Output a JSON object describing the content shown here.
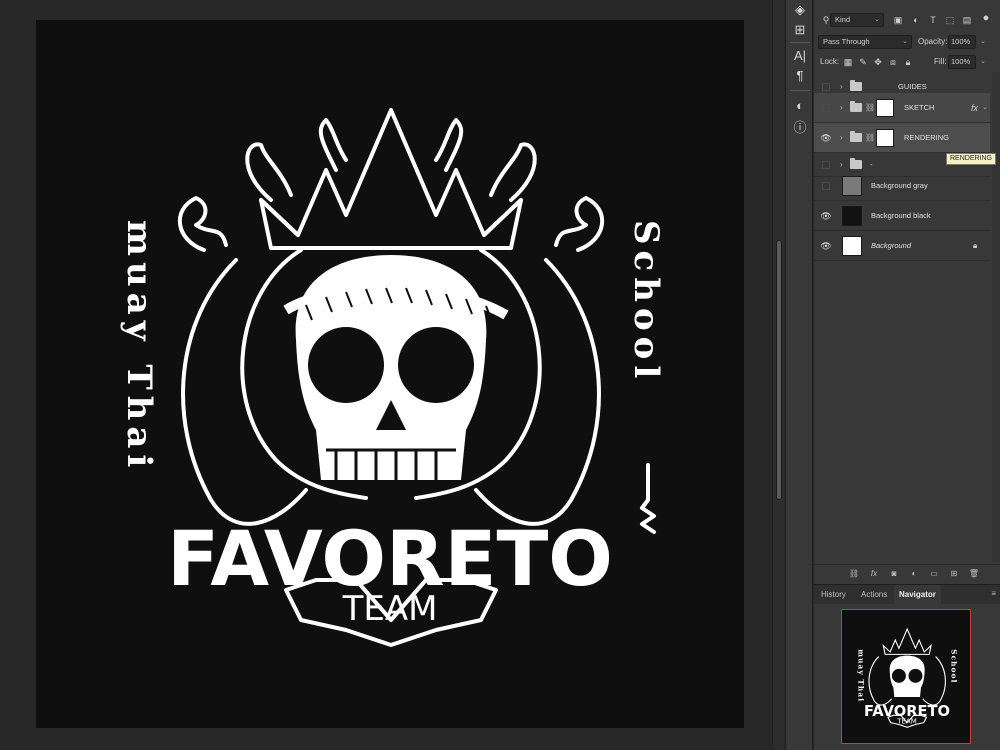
{
  "canvas": {
    "logo_top_text": "",
    "left_vertical_text": "muay Thai",
    "right_vertical_text": "School",
    "brand_name": "FAVORETO",
    "brand_sub": "TEAM"
  },
  "tools": [
    "arrange-icon",
    "pattern-icon",
    "character-icon",
    "paragraph-icon",
    "adjust-icon",
    "info-icon"
  ],
  "layers_panel": {
    "filter_kind": "Kind",
    "blend_mode": "Pass Through",
    "opacity_label": "Opacity:",
    "opacity_value": "100%",
    "lock_label": "Lock:",
    "fill_label": "Fill:",
    "fill_value": "100%",
    "layers": [
      {
        "name": "GUIDES",
        "type": "group",
        "visible": false
      },
      {
        "name": "SKETCH",
        "type": "group",
        "visible": false,
        "fx": "fx"
      },
      {
        "name": "RENDERING",
        "type": "group",
        "visible": true,
        "selected": true
      },
      {
        "name": "-",
        "type": "group",
        "visible": false
      },
      {
        "name": "Background gray",
        "type": "layer",
        "visible": false,
        "swatch": "#7a7a7a"
      },
      {
        "name": "Background black",
        "type": "layer",
        "visible": true,
        "swatch": "#111111"
      },
      {
        "name": "Background",
        "type": "layer",
        "visible": true,
        "swatch": "#ffffff",
        "locked": true
      }
    ],
    "tooltip": "RENDERING"
  },
  "bottom_panel": {
    "tabs": [
      "History",
      "Actions",
      "Navigator"
    ],
    "active_tab": "Navigator"
  },
  "colors": {
    "canvas_bg": "#0f0f0f",
    "workspace": "#282828",
    "panel": "#383838",
    "selected_row": "#4d4d4d",
    "navigator_frame": "#d23a3a"
  }
}
